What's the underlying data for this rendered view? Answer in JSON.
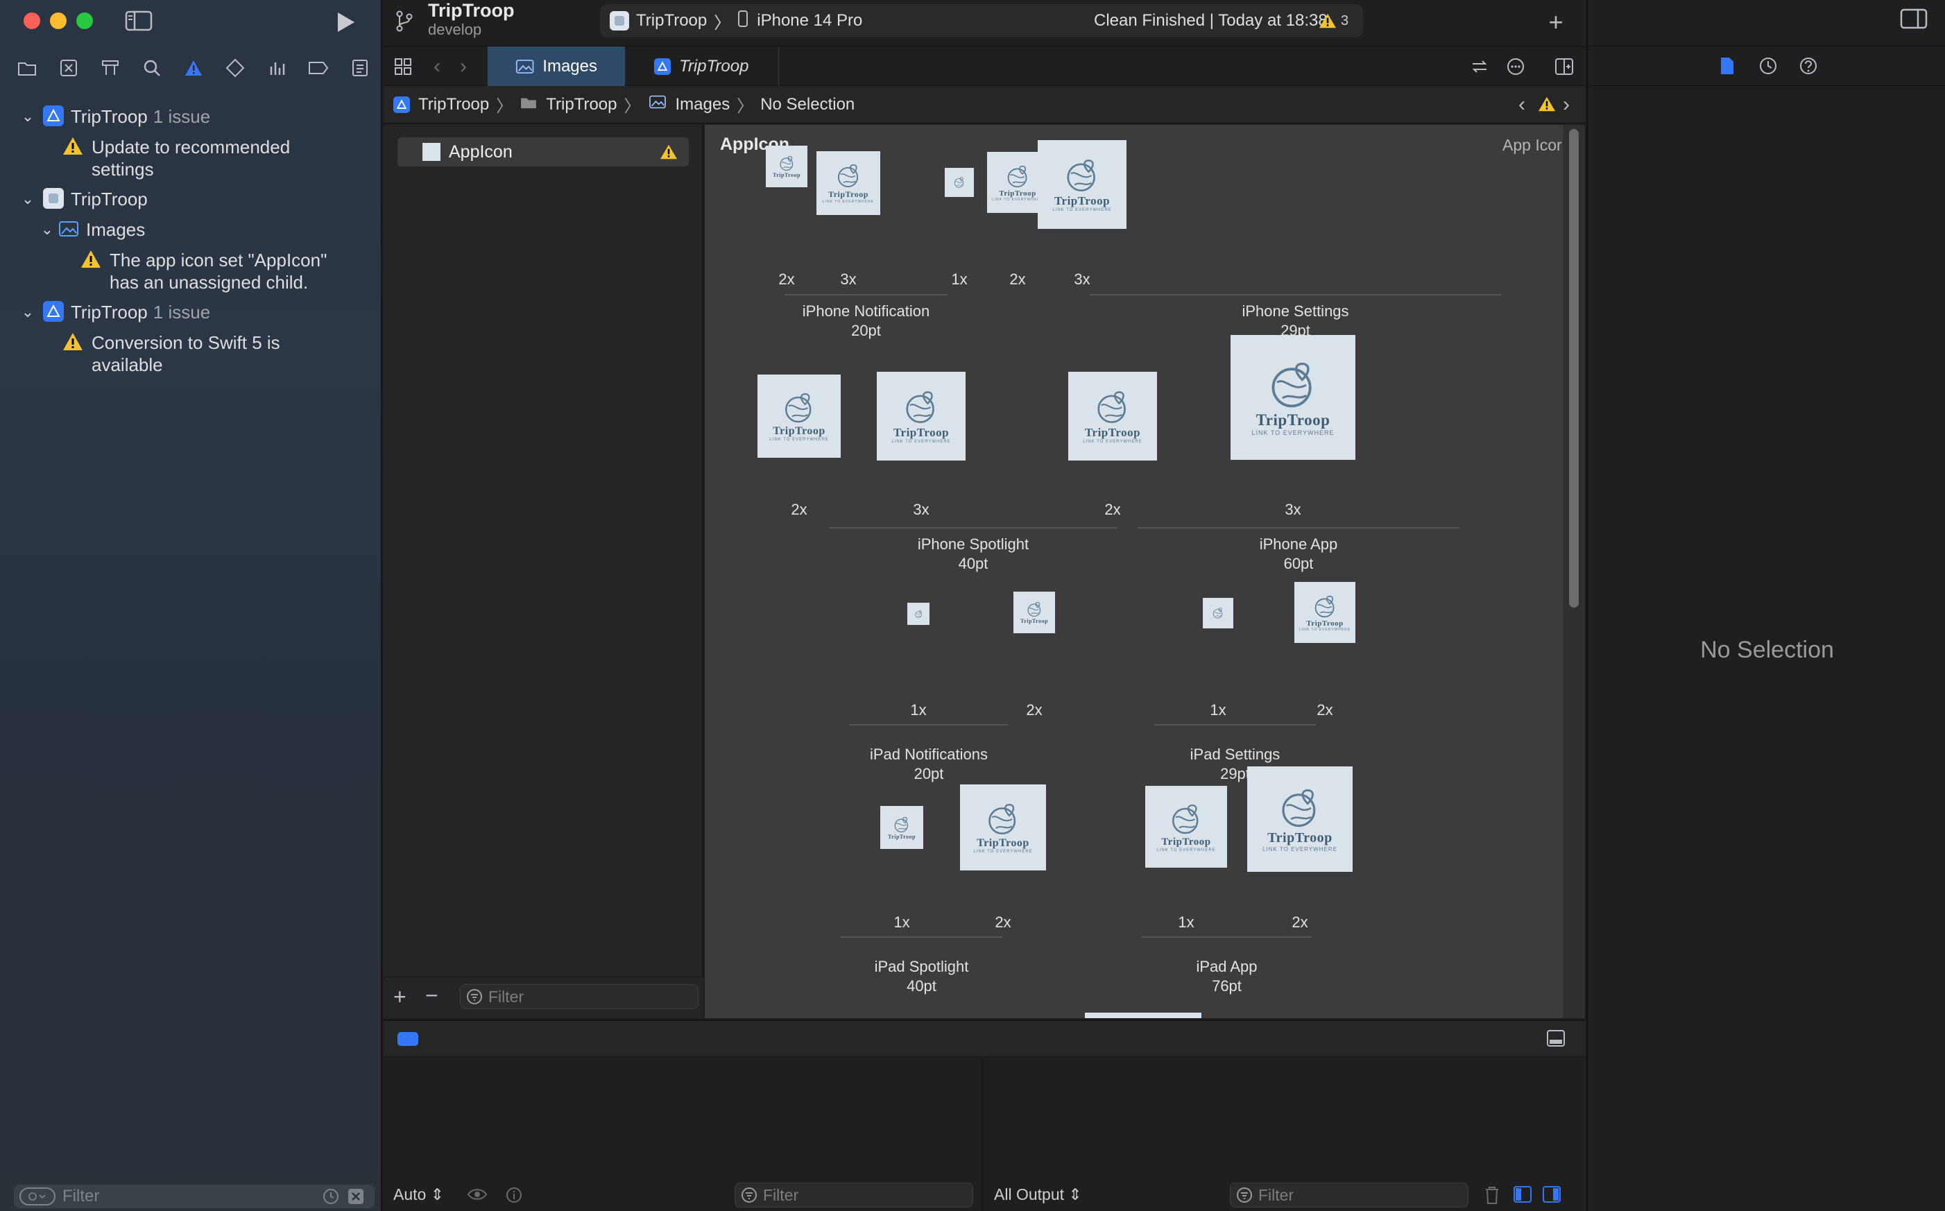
{
  "window": {
    "project_name": "TripTroop",
    "branch": "develop"
  },
  "scheme": {
    "target": "TripTroop",
    "device": "iPhone 14 Pro",
    "status": "Clean Finished | Today at 18:38",
    "warning_count": "3"
  },
  "navigator": {
    "issues": [
      {
        "title": "TripTroop",
        "count": "1 issue"
      },
      {
        "message_line1": "Update to recommended",
        "message_line2": "settings"
      },
      {
        "title": "TripTroop"
      },
      {
        "title": "Images"
      },
      {
        "message_line1": "The app icon set \"AppIcon\"",
        "message_line2": "has an unassigned child."
      },
      {
        "title": "TripTroop",
        "count": "1 issue"
      },
      {
        "message_line1": "Conversion to Swift 5 is",
        "message_line2": "available"
      }
    ],
    "filter_placeholder": "Filter"
  },
  "tabs": [
    {
      "label": "Images"
    },
    {
      "label": "TripTroop"
    }
  ],
  "jumpbar": {
    "items": [
      "TripTroop",
      "TripTroop",
      "Images",
      "No Selection"
    ]
  },
  "asset_list": {
    "items": [
      {
        "label": "AppIcon"
      }
    ],
    "filter_placeholder": "Filter"
  },
  "canvas": {
    "title": "AppIcon",
    "right_label": "App Icor",
    "logo_name": "TripTroop",
    "logo_tag": "LINK TO EVERYWHERE",
    "groups": [
      {
        "name": "iPhone Notification",
        "size": "20pt",
        "scales": [
          "2x",
          "3x"
        ]
      },
      {
        "name": "iPhone Settings",
        "size": "29pt",
        "scales": [
          "1x",
          "2x",
          "3x"
        ]
      },
      {
        "name": "iPhone Spotlight",
        "size": "40pt",
        "scales": [
          "2x",
          "3x"
        ]
      },
      {
        "name": "iPhone App",
        "size": "60pt",
        "scales": [
          "2x",
          "3x"
        ]
      },
      {
        "name": "iPad Notifications",
        "size": "20pt",
        "scales": [
          "1x",
          "2x"
        ]
      },
      {
        "name": "iPad Settings",
        "size": "29pt",
        "scales": [
          "1x",
          "2x"
        ]
      },
      {
        "name": "iPad Spotlight",
        "size": "40pt",
        "scales": [
          "1x",
          "2x"
        ]
      },
      {
        "name": "iPad App",
        "size": "76pt",
        "scales": [
          "1x",
          "2x"
        ]
      }
    ]
  },
  "debug": {
    "auto_label": "Auto",
    "output_label": "All Output",
    "filter_placeholder": "Filter"
  },
  "inspector": {
    "empty_label": "No Selection"
  },
  "colors": {
    "accent": "#3478f6",
    "warning": "#f5c330",
    "tab_selected": "#2f4a69"
  }
}
